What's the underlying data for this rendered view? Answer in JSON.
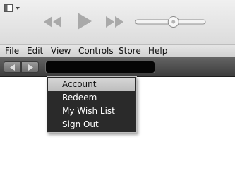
{
  "toolbar": {
    "sidebar_toggle_icon": "sidebar-toggle-icon",
    "rewind_icon": "rewind-icon",
    "play_icon": "play-icon",
    "fast_forward_icon": "fast-forward-icon",
    "volume_level": 0.55
  },
  "menubar": {
    "items": [
      "File",
      "Edit",
      "View",
      "Controls",
      "Store",
      "Help"
    ]
  },
  "navbar": {
    "back_icon": "back-arrow-icon",
    "forward_icon": "forward-arrow-icon",
    "location_text": ""
  },
  "account_menu": {
    "items": [
      {
        "label": "Account",
        "selected": true
      },
      {
        "label": "Redeem",
        "selected": false
      },
      {
        "label": "My Wish List",
        "selected": false
      },
      {
        "label": "Sign Out",
        "selected": false
      }
    ]
  },
  "colors": {
    "toolbar_bg": "#e4e4e4",
    "navbar_bg": "#4a4a4a",
    "menu_bg": "#2a2a2a",
    "menu_selected_bg": "#c8c8c8",
    "location_bg": "#050505"
  }
}
